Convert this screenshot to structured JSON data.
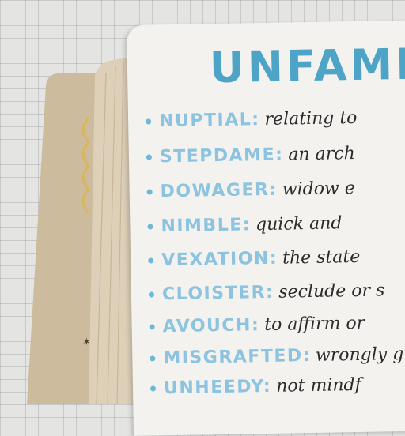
{
  "page": {
    "title": "UNFAMI",
    "entries": [
      {
        "term": "NUPTIAL:",
        "definition": "relating to"
      },
      {
        "term": "STEPDAME:",
        "definition": "an arch"
      },
      {
        "term": "DOWAGER:",
        "definition": "widow e"
      },
      {
        "term": "NIMBLE:",
        "definition": "quick and"
      },
      {
        "term": "VEXATION:",
        "definition": "the state"
      },
      {
        "term": "CLOISTER:",
        "definition": "seclude or s"
      },
      {
        "term": "AVOUCH:",
        "definition": "to affirm or"
      },
      {
        "term": "MISGRAFTED:",
        "definition": "wrongly g"
      },
      {
        "term": "UNHEEDY:",
        "definition": "not mindf"
      }
    ]
  },
  "colors": {
    "title": "#4ea4c6",
    "term": "#8cc3e0",
    "definition": "#2b2b2b",
    "bullet": "#6bb8d9",
    "page": "#f3f2ee",
    "cover": "#cdbb9e",
    "page_edges": "#ddcfb8",
    "grid_mat": "#e4e4e2"
  }
}
